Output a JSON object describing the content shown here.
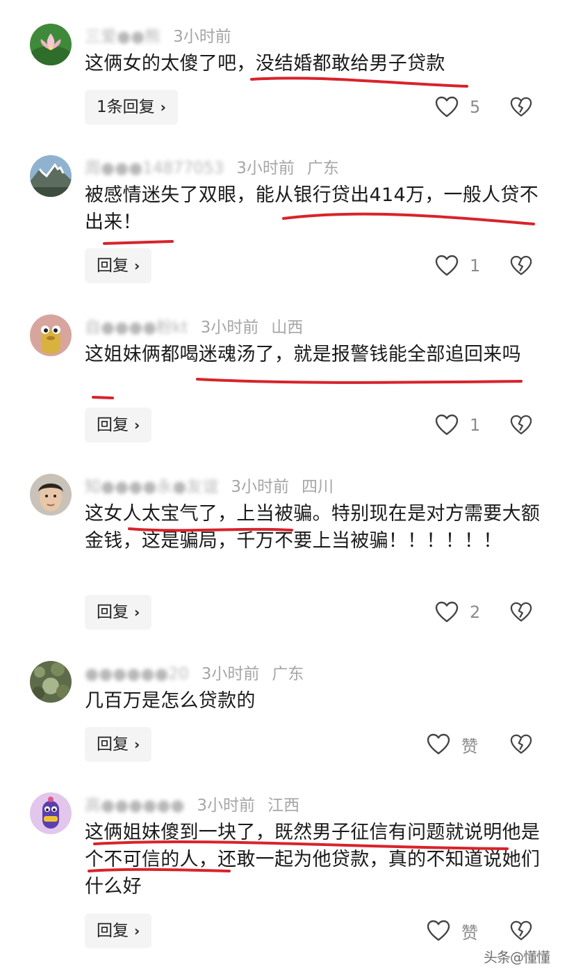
{
  "comments": [
    {
      "user": "三爱●●熊",
      "time": "3小时前",
      "location": "",
      "text": "这俩女的太傻了吧，没结婚都敢给男子贷款",
      "reply_label": "1条回复",
      "likes": "5"
    },
    {
      "user": "周●●●14877053",
      "time": "3小时前",
      "location": "广东",
      "text": "被感情迷失了双眼，能从银行贷出414万，一般人贷不出来！",
      "reply_label": "回复",
      "likes": "1"
    },
    {
      "user": "自●●●●粉kt",
      "time": "3小时前",
      "location": "山西",
      "text": "这姐妹俩都喝迷魂汤了，就是报警钱能全部追回来吗",
      "reply_label": "回复",
      "likes": "1"
    },
    {
      "user": "知●●●●永●友谊",
      "time": "3小时前",
      "location": "四川",
      "text": "这女人太宝气了，上当被骗。特别现在是对方需要大额金钱，这是骗局，千万不要上当被骗！！！！！！",
      "reply_label": "回复",
      "likes": "2"
    },
    {
      "user": "●●●●●●20",
      "time": "3小时前",
      "location": "广东",
      "text": "几百万是怎么贷款的",
      "reply_label": "回复",
      "likes": "赞"
    },
    {
      "user": "高●●●●●●",
      "time": "3小时前",
      "location": "江西",
      "text": "这俩姐妹傻到一块了，既然男子征信有问题就说明他是个不可信的人，还敢一起为他贷款，真的不知道说她们什么好",
      "reply_label": "回复",
      "likes": "赞"
    }
  ],
  "icons": {
    "like": "heart-outline-icon",
    "dislike": "broken-heart-icon",
    "chevron": "chevron-right-icon"
  },
  "colors": {
    "underline": "#d8232a",
    "meta": "#a6a6a6",
    "text": "#1a1a1a",
    "reply_bg": "#f4f4f4"
  },
  "watermark": "头条@懂懂"
}
